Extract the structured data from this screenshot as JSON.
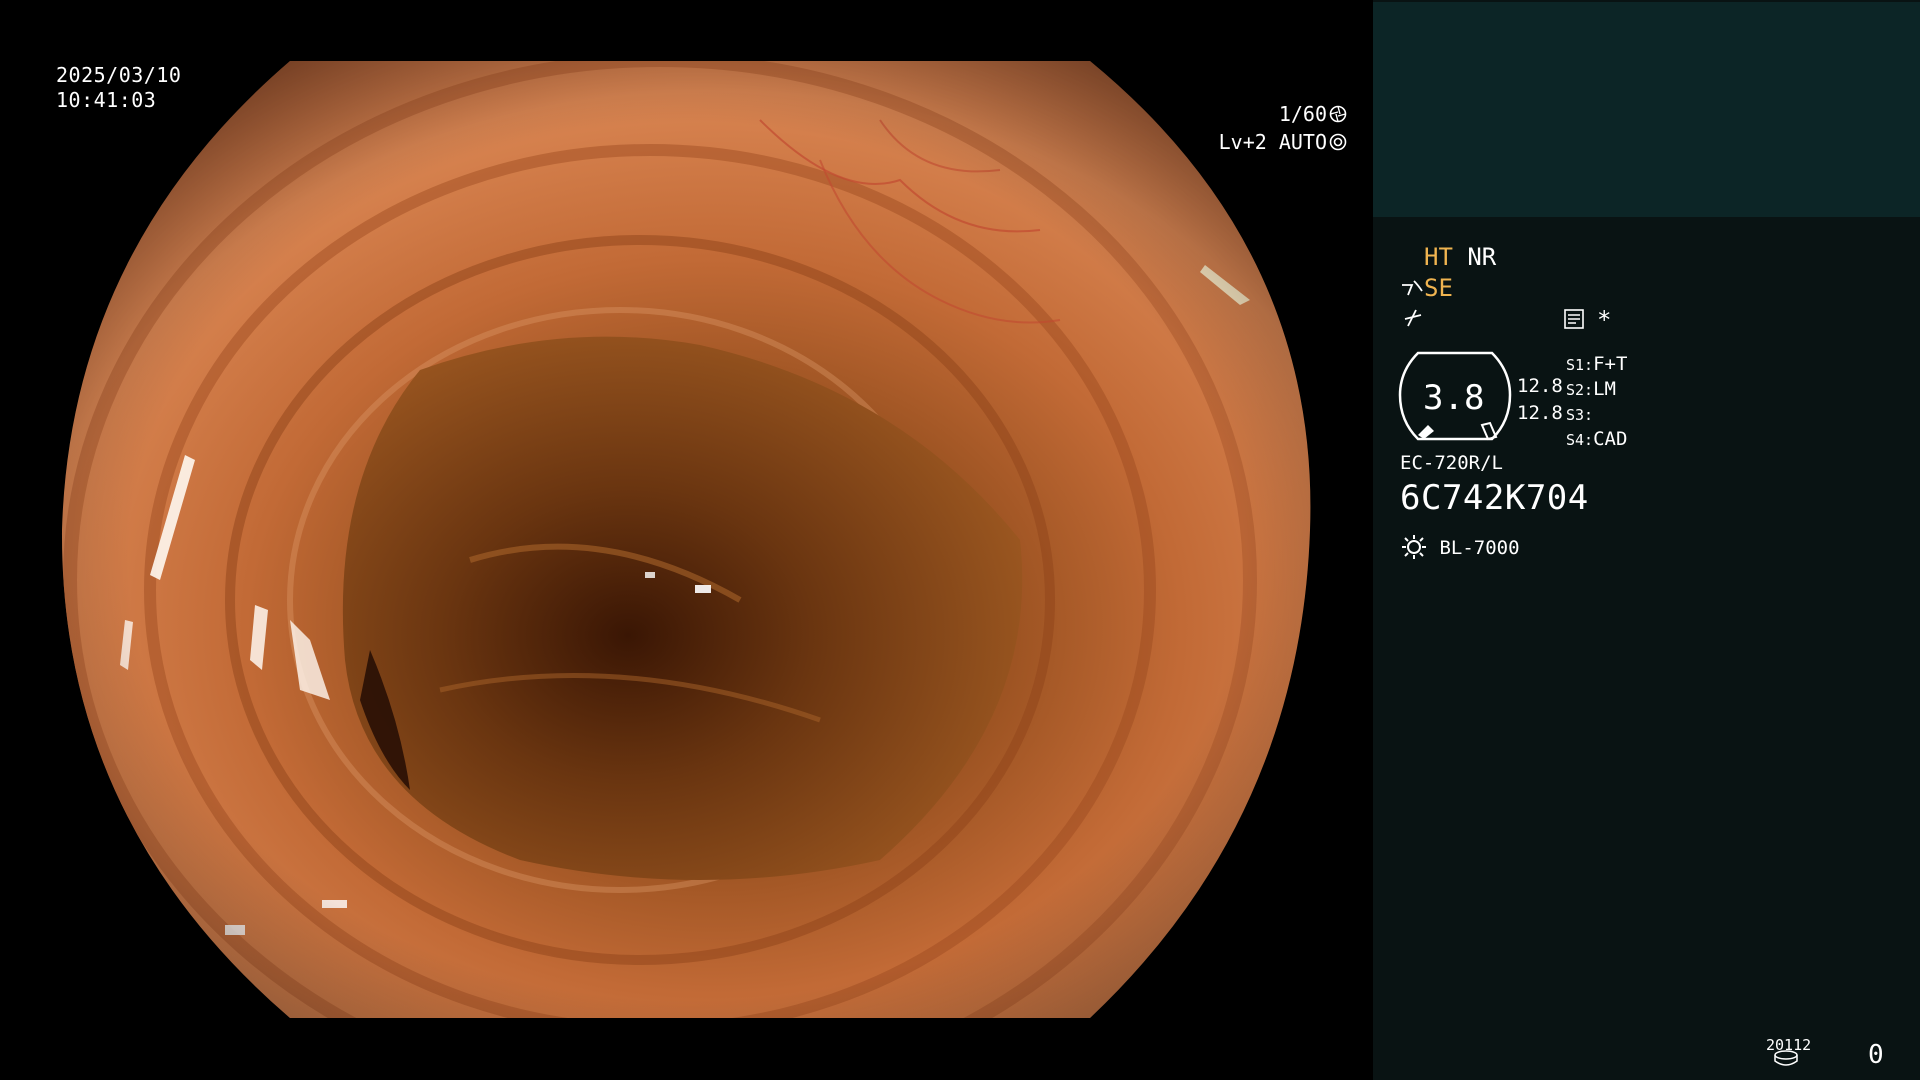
{
  "overlay": {
    "date": "2025/03/10",
    "time": "10:41:03",
    "shutter": "1/60",
    "level": "Lv+2 AUTO"
  },
  "panel": {
    "ht": "HT",
    "nr": "NR",
    "se": "SE",
    "zoom_value": "3.8",
    "value_1": "12.8",
    "value_2": "12.8",
    "s1_label": "S1:",
    "s1_value": "F+T",
    "s2_label": "S2:",
    "s2_value": "LM",
    "s3_label": "S3:",
    "s3_value": "",
    "s4_label": "S4:",
    "s4_value": "CAD",
    "asterisk": "*",
    "scope_model": "EC-720R/L",
    "scope_serial": "6C742K704",
    "light_source": "BL-7000",
    "media_code": "20112",
    "counter": "0"
  },
  "colors": {
    "panel_bg": "#091313",
    "panel_top_bg": "#0c2526",
    "accent_amber": "#f0b450"
  },
  "icons": [
    "aperture-icon",
    "iris-icon",
    "freeze-icon",
    "enhance-icon",
    "document-icon",
    "lamp-icon",
    "disk-icon"
  ]
}
